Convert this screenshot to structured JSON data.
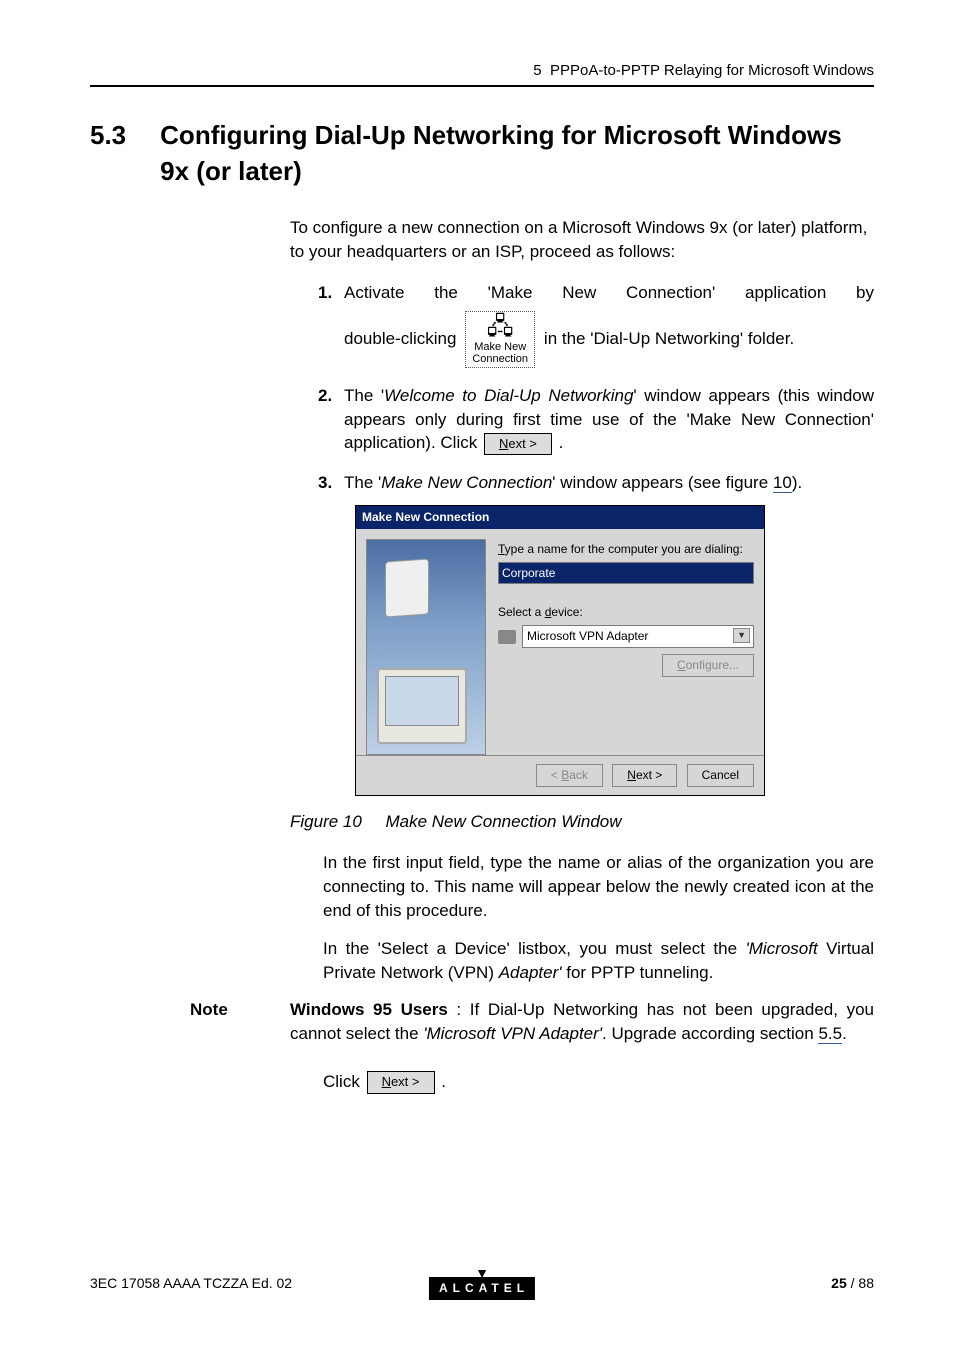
{
  "header": {
    "chapter_prefix": "5",
    "chapter_title": "PPPoA-to-PPTP Relaying for Microsoft Windows"
  },
  "section": {
    "number": "5.3",
    "title": "Configuring Dial-Up Networking for Microsoft Windows 9x (or later)"
  },
  "intro": "To configure a new connection on a Microsoft Windows 9x (or later) platform, to your headquarters or an ISP, proceed as follows:",
  "steps": {
    "s1": {
      "num": "1.",
      "t1": "Activate the 'Make New Connection' application by double-clicking ",
      "icon_line1": "Make New",
      "icon_line2": "Connection",
      "t2": " in the 'Dial-Up Networking' folder."
    },
    "s2": {
      "num": "2.",
      "t1": "The '",
      "ital1": "Welcome to Dial-Up Networking",
      "t2": "' window appears (this window appears only during first time use of the 'Make New Connection' application). Click ",
      "btn_prefix": "N",
      "btn_suffix": "ext >",
      "t3": " ."
    },
    "s3": {
      "num": "3.",
      "t1": "The '",
      "ital1": "Make New Connection",
      "t2": "' window appears (see figure ",
      "xref": "10",
      "t3": ")."
    }
  },
  "wizard": {
    "title": "Make New Connection",
    "label_type_prefix": "T",
    "label_type_suffix": "ype a name for the computer you are dialing:",
    "input_value": "Corporate",
    "label_device_prefix": "Select a ",
    "label_device_u": "d",
    "label_device_suffix": "evice:",
    "select_value": "Microsoft VPN Adapter",
    "configure_prefix": "C",
    "configure_suffix": "onfigure...",
    "back_prefix": "< ",
    "back_u": "B",
    "back_suffix": "ack",
    "next_prefix": "N",
    "next_suffix": "ext >",
    "cancel": "Cancel"
  },
  "figure": {
    "prefix": "Figure 10",
    "caption": "Make New Connection Window"
  },
  "after_fig": {
    "p1": "In the first input field, type the name or alias of the organization you are connecting to. This name will appear below the newly created icon at the end of this procedure.",
    "p2a": "In the 'Select a Device' listbox, you must select the ",
    "p2i1": "'Microsoft",
    "p2b": " Virtual Private Network (VPN) ",
    "p2i2": "Adapter'",
    "p2c": " for PPTP tunneling."
  },
  "note": {
    "label": "Note",
    "bold": "Windows 95 Users",
    "t1": " : If Dial-Up Networking has not been upgraded, you cannot select the ",
    "ital": "'Microsoft VPN Adapter'",
    "t2": ".   Upgrade according section ",
    "xref": "5.5",
    "t3": "."
  },
  "click_line": {
    "prefix": "Click ",
    "btn_prefix": "N",
    "btn_suffix": "ext >",
    "suffix": " ."
  },
  "footer": {
    "docid": "3EC 17058 AAAA TCZZA Ed. 02",
    "logo": "ALCATEL",
    "page_current": "25",
    "page_sep": " / ",
    "page_total": "88"
  }
}
